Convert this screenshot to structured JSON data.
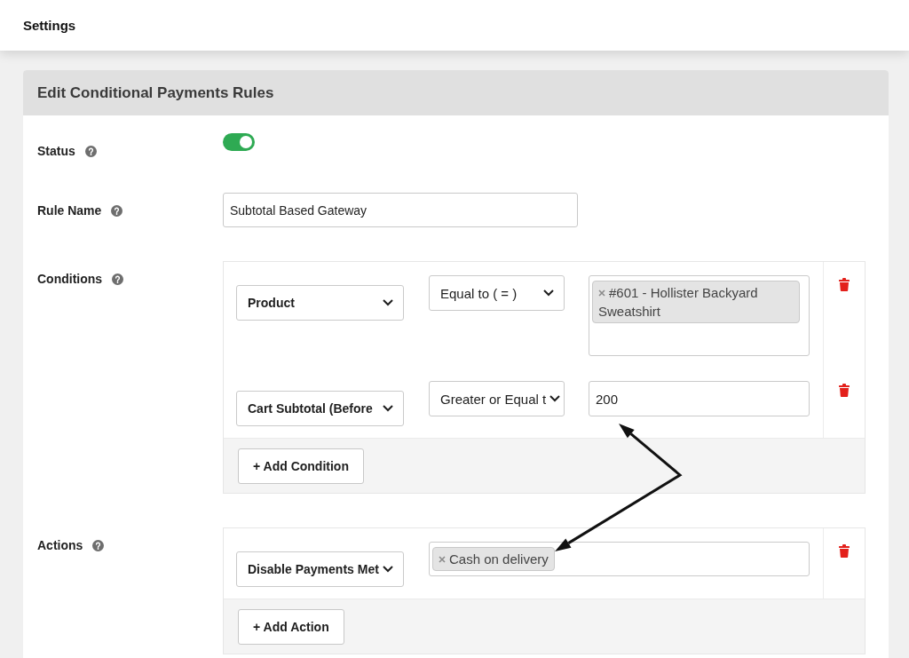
{
  "page": {
    "title": "Settings"
  },
  "panel": {
    "title": "Edit Conditional Payments Rules"
  },
  "status": {
    "label": "Status",
    "on": true
  },
  "rule_name": {
    "label": "Rule Name",
    "value": "Subtotal Based Gateway"
  },
  "conditions": {
    "label": "Conditions",
    "rows": [
      {
        "field": "Product",
        "operator": "Equal to ( = )",
        "kind": "tags",
        "tags": [
          "#601 - Hollister Backyard Sweatshirt"
        ]
      },
      {
        "field": "Cart Subtotal (Before",
        "operator": "Greater or Equal t",
        "kind": "text",
        "value": "200"
      }
    ],
    "add_button": "+ Add Condition"
  },
  "actions": {
    "label": "Actions",
    "rows": [
      {
        "action": "Disable Payments Met",
        "tags": [
          "Cash on delivery"
        ]
      }
    ],
    "add_button": "+ Add Action"
  }
}
